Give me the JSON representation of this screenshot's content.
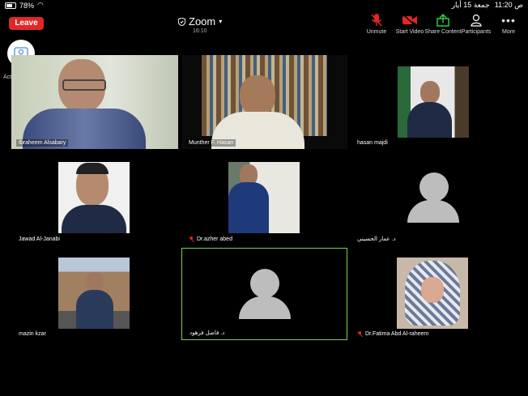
{
  "status": {
    "battery": "78%",
    "time": "11:20 ص",
    "date": "جمعة 15 أيار"
  },
  "toolbar": {
    "leave_label": "Leave",
    "title": "Zoom",
    "meeting_time": "16:10",
    "buttons": [
      {
        "label": "Unmute",
        "icon": "mic-muted-icon",
        "color": "#e02828"
      },
      {
        "label": "Start Video",
        "icon": "video-off-icon",
        "color": "#e02828"
      },
      {
        "label": "Share Content",
        "icon": "share-icon",
        "color": "#2ecc40"
      },
      {
        "label": "Participants",
        "icon": "participants-icon",
        "color": "#ffffff"
      },
      {
        "label": "More",
        "icon": "more-icon",
        "color": "#ffffff"
      }
    ]
  },
  "self": {
    "label": "Active ..."
  },
  "participants": [
    {
      "name": "Ibraheem Alsabary",
      "muted": false
    },
    {
      "name": "Munther F. Hasan",
      "muted": false
    },
    {
      "name": "hasan majdi",
      "muted": false
    },
    {
      "name": "Jawad Al-Janabi",
      "muted": false
    },
    {
      "name": "Dr.azher abed",
      "muted": true
    },
    {
      "name": "د. عمار الحسيني",
      "muted": false
    },
    {
      "name": "mazin kzar",
      "muted": false
    },
    {
      "name": "د. فاضل فرهود",
      "muted": false
    },
    {
      "name": "Dr.Fatima Abd Al-raheem",
      "muted": true
    }
  ],
  "colors": {
    "active_speaker_border": "#7ad34a",
    "leave": "#e02828"
  }
}
